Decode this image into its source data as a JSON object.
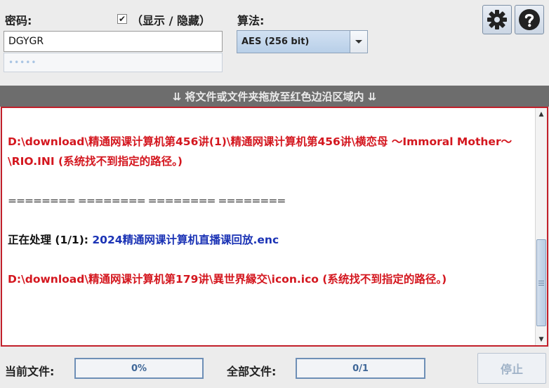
{
  "password": {
    "label": "密码:",
    "value": "DGYGR",
    "confirm_mask": "•••••",
    "show_checkbox_checked": true,
    "show_hide_label": "（显示 / 隐藏）"
  },
  "algorithm": {
    "label": "算法:",
    "selected": "AES (256 bit)"
  },
  "toolbar": {
    "settings_icon": "gear-icon",
    "help_icon": "question-icon"
  },
  "dropzone": {
    "hint": "⇊ 将文件或文件夹拖放至红色边沿区域内 ⇊"
  },
  "log": {
    "error1": "D:\\download\\精通网课计算机第456讲(1)\\精通网课计算机第456讲\\横恋母 ～Immoral Mother～\\RIO.INI (系统找不到指定的路径。)",
    "separator": "======== ======== ======== ========",
    "processing_prefix": "正在处理 (1/1): ",
    "processing_file": "2024精通网课计算机直播课回放.enc",
    "error2": "D:\\download\\精通网课计算机第179讲\\異世界縁交\\icon.ico (系统找不到指定的路径。)"
  },
  "status": {
    "current_label": "当前文件:",
    "current_progress": "0%",
    "current_fraction": 0,
    "all_label": "全部文件:",
    "all_progress": "0/1",
    "all_fraction": 0,
    "stop_label": "停止"
  },
  "colors": {
    "drop_border": "#c2202a",
    "error_text": "#d4171f",
    "file_text": "#1b33b5",
    "progress_border": "#6e8fb6"
  }
}
